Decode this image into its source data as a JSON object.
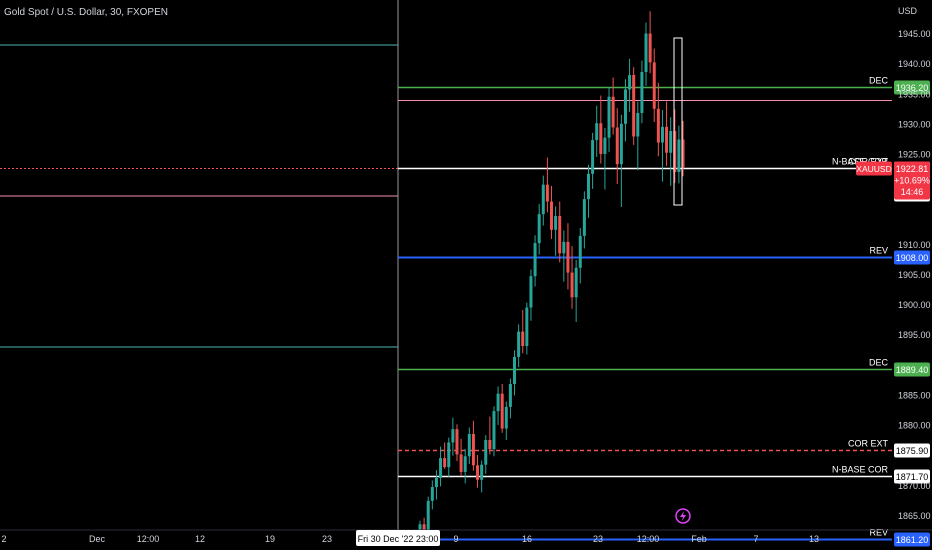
{
  "symbol": {
    "title": "Gold Spot / U.S. Dollar, 30, FXOPEN"
  },
  "colors": {
    "background": "#000000",
    "up": "#26a69a",
    "down": "#ef5350",
    "green_line": "#4caf50",
    "blue_line": "#2962ff",
    "pink_line": "#f48fb1",
    "white_line": "#ffffff",
    "teal_line": "#4db6ac",
    "price_badge": "#f23645"
  },
  "chart_data": {
    "type": "candlestick",
    "y_axis": {
      "unit_label": "USD",
      "ticks": [
        "1945.00",
        "1940.00",
        "1935.00",
        "1930.00",
        "1925.00",
        "1910.00",
        "1905.00",
        "1900.00",
        "1895.00",
        "1885.00",
        "1880.00",
        "1870.00",
        "1865.00"
      ],
      "range": [
        1861,
        1949
      ]
    },
    "x_axis": {
      "ticks": [
        "2",
        "Dec",
        "12:00",
        "12",
        "19",
        "23",
        "9",
        "16",
        "23",
        "12:00",
        "Feb",
        "7",
        "13"
      ],
      "crosshair_label": "Fri 30 Dec '22  23:00"
    },
    "levels": [
      {
        "label": "DEC",
        "price": 1936.2,
        "price_label": "1936.20",
        "style": "green",
        "badge": true
      },
      {
        "label": "",
        "price": 1934.1,
        "price_label": "",
        "style": "pink",
        "badge": false
      },
      {
        "label": "COR EXT",
        "price": 1922.81,
        "price_label": "",
        "style": "red-dotted",
        "badge": false
      },
      {
        "label": "N-BASE COR",
        "price": 1922.7,
        "price_label": "1922.70",
        "style": "white",
        "badge": false
      },
      {
        "label": "REV",
        "price": 1908.0,
        "price_label": "1908.00",
        "style": "blue",
        "badge": true
      },
      {
        "label": "DEC",
        "price": 1889.4,
        "price_label": "1889.40",
        "style": "green",
        "badge": true
      },
      {
        "label": "COR EXT",
        "price": 1875.9,
        "price_label": "1875.90",
        "style": "red-dashed",
        "badge": false
      },
      {
        "label": "N-BASE COR",
        "price": 1871.7,
        "price_label": "1871.70",
        "style": "white",
        "badge": false
      },
      {
        "label": "REV",
        "price": 1861.2,
        "price_label": "1861.20",
        "style": "blue",
        "badge": true
      }
    ],
    "extra_price_labels": [
      "1918.50"
    ],
    "current_price": {
      "symbol": "XAUUSD",
      "price": "1922.81",
      "change": "+10.69%",
      "countdown": "14:46"
    },
    "candles": [
      [
        1862.5,
        1864.2,
        1860.1,
        1863.6
      ],
      [
        1863.6,
        1864.7,
        1861.2,
        1862.0
      ],
      [
        1862.0,
        1868.2,
        1861.4,
        1867.5
      ],
      [
        1867.5,
        1870.9,
        1866.1,
        1869.8
      ],
      [
        1869.8,
        1872.6,
        1867.7,
        1871.3
      ],
      [
        1871.3,
        1876.5,
        1869.9,
        1874.6
      ],
      [
        1874.6,
        1877.2,
        1872.8,
        1873.1
      ],
      [
        1873.1,
        1878.0,
        1871.5,
        1877.2
      ],
      [
        1877.2,
        1881.3,
        1875.0,
        1879.4
      ],
      [
        1879.4,
        1880.2,
        1874.1,
        1875.2
      ],
      [
        1875.2,
        1877.8,
        1871.6,
        1872.3
      ],
      [
        1872.3,
        1876.1,
        1870.4,
        1874.9
      ],
      [
        1874.9,
        1879.7,
        1873.6,
        1878.6
      ],
      [
        1878.6,
        1880.8,
        1872.5,
        1873.4
      ],
      [
        1873.4,
        1875.1,
        1869.7,
        1871.0
      ],
      [
        1871.0,
        1874.2,
        1868.9,
        1873.5
      ],
      [
        1873.5,
        1878.4,
        1872.0,
        1877.6
      ],
      [
        1877.6,
        1881.5,
        1875.2,
        1876.1
      ],
      [
        1876.1,
        1883.2,
        1874.9,
        1882.4
      ],
      [
        1882.4,
        1886.5,
        1880.1,
        1885.3
      ],
      [
        1885.3,
        1886.9,
        1878.8,
        1879.5
      ],
      [
        1879.5,
        1884.0,
        1877.6,
        1883.1
      ],
      [
        1883.1,
        1887.8,
        1881.2,
        1886.9
      ],
      [
        1886.9,
        1892.5,
        1885.0,
        1891.4
      ],
      [
        1891.4,
        1896.8,
        1889.7,
        1895.6
      ],
      [
        1895.6,
        1899.2,
        1892.0,
        1893.2
      ],
      [
        1893.2,
        1900.4,
        1891.8,
        1899.6
      ],
      [
        1899.6,
        1905.9,
        1897.4,
        1904.8
      ],
      [
        1904.8,
        1911.6,
        1903.1,
        1910.3
      ],
      [
        1910.3,
        1916.8,
        1908.4,
        1915.1
      ],
      [
        1915.1,
        1921.5,
        1913.2,
        1920.0
      ],
      [
        1920.0,
        1924.5,
        1915.4,
        1917.2
      ],
      [
        1917.2,
        1919.8,
        1911.0,
        1912.5
      ],
      [
        1912.5,
        1916.4,
        1908.2,
        1914.8
      ],
      [
        1914.8,
        1917.2,
        1907.1,
        1908.6
      ],
      [
        1908.6,
        1912.4,
        1903.9,
        1910.5
      ],
      [
        1910.5,
        1913.6,
        1902.6,
        1905.4
      ],
      [
        1905.4,
        1909.8,
        1899.4,
        1901.3
      ],
      [
        1901.3,
        1907.5,
        1897.2,
        1906.2
      ],
      [
        1906.2,
        1912.8,
        1903.6,
        1911.5
      ],
      [
        1911.5,
        1918.9,
        1909.4,
        1917.6
      ],
      [
        1917.6,
        1923.3,
        1914.5,
        1921.8
      ],
      [
        1921.8,
        1928.6,
        1919.3,
        1927.4
      ],
      [
        1927.4,
        1933.1,
        1924.6,
        1930.2
      ],
      [
        1930.2,
        1934.8,
        1923.5,
        1925.1
      ],
      [
        1925.1,
        1929.4,
        1919.2,
        1927.8
      ],
      [
        1927.8,
        1936.2,
        1925.4,
        1934.6
      ],
      [
        1934.6,
        1937.8,
        1928.3,
        1929.5
      ],
      [
        1929.5,
        1932.7,
        1920.1,
        1923.4
      ],
      [
        1923.4,
        1931.6,
        1916.3,
        1930.1
      ],
      [
        1930.1,
        1937.5,
        1927.2,
        1935.8
      ],
      [
        1935.8,
        1940.9,
        1932.1,
        1938.2
      ],
      [
        1938.2,
        1939.5,
        1926.6,
        1928.0
      ],
      [
        1928.0,
        1933.8,
        1922.4,
        1931.9
      ],
      [
        1931.9,
        1940.6,
        1930.2,
        1938.7
      ],
      [
        1938.7,
        1946.9,
        1936.4,
        1945.1
      ],
      [
        1945.1,
        1948.8,
        1938.5,
        1940.3
      ],
      [
        1940.3,
        1942.6,
        1930.4,
        1932.6
      ],
      [
        1932.6,
        1936.9,
        1924.7,
        1927.0
      ],
      [
        1927.0,
        1932.4,
        1920.5,
        1929.6
      ],
      [
        1929.6,
        1933.8,
        1923.1,
        1925.3
      ],
      [
        1925.3,
        1931.2,
        1919.8,
        1928.9
      ],
      [
        1928.9,
        1932.5,
        1920.3,
        1922.1
      ],
      [
        1922.1,
        1929.8,
        1920.2,
        1927.5
      ],
      [
        1927.5,
        1930.6,
        1921.4,
        1922.8
      ]
    ]
  }
}
